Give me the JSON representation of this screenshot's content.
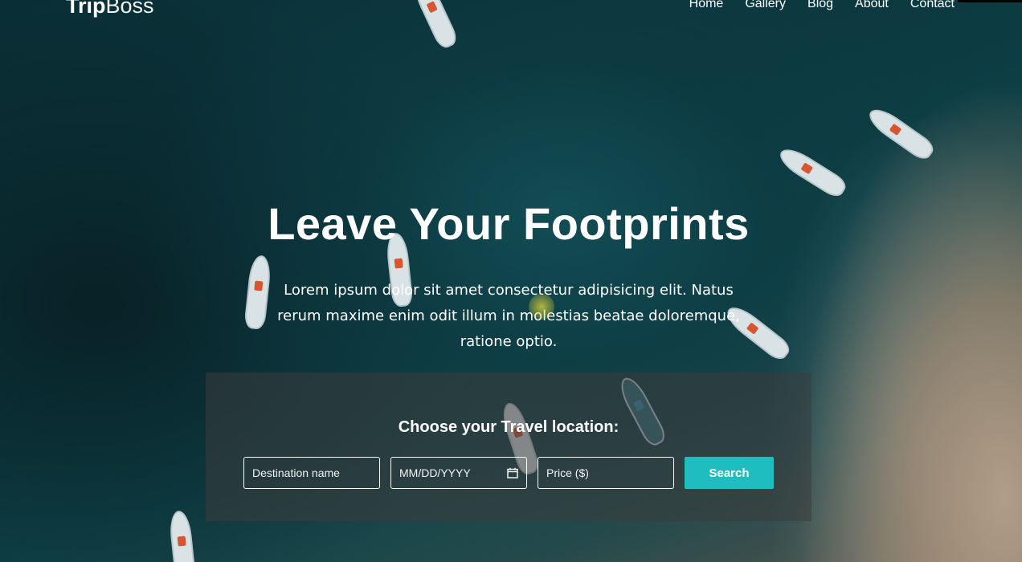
{
  "brand": {
    "logo_bold": "Trip",
    "logo_light": "Boss"
  },
  "nav": {
    "items": [
      {
        "label": "Home"
      },
      {
        "label": "Gallery"
      },
      {
        "label": "Blog"
      },
      {
        "label": "About"
      },
      {
        "label": "Contact"
      }
    ]
  },
  "hero": {
    "title": "Leave Your Footprints",
    "text": "Lorem ipsum dolor sit amet consectetur adipisicing elit. Natus rerum maxime enim odit illum in molestias beatae doloremque, ratione optio."
  },
  "search": {
    "title": "Choose your Travel location:",
    "destination_placeholder": "Destination name",
    "date_placeholder": "MM/DD/YYYY",
    "price_placeholder": "Price ($)",
    "button_label": "Search"
  },
  "colors": {
    "accent": "#1fbcc0",
    "panel": "rgba(60,60,60,0.55)"
  },
  "icons": {
    "calendar": "calendar-icon"
  }
}
